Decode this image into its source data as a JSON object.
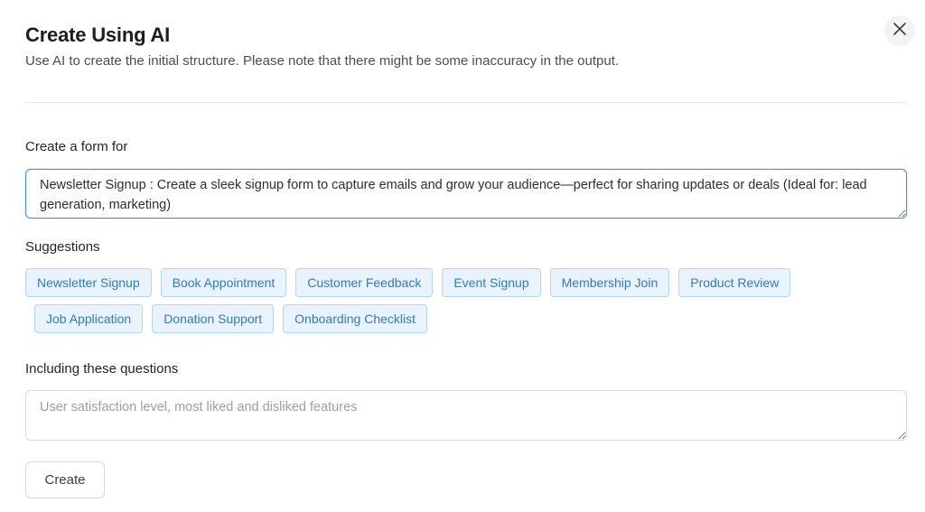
{
  "header": {
    "title": "Create Using AI",
    "subtitle": "Use AI to create the initial structure. Please note that there might be some inaccuracy in the output."
  },
  "form_for": {
    "label": "Create a form for",
    "value": "Newsletter Signup : Create a sleek signup form to capture emails and grow your audience—perfect for sharing updates or deals (Ideal for: lead generation, marketing)"
  },
  "suggestions": {
    "label": "Suggestions",
    "row1": [
      "Newsletter Signup",
      "Book Appointment",
      "Customer Feedback",
      "Event Signup",
      "Membership Join",
      "Product Review"
    ],
    "row2": [
      "Job Application",
      "Donation Support",
      "Onboarding Checklist"
    ]
  },
  "questions": {
    "label": "Including these questions",
    "value": "",
    "placeholder": "User satisfaction level, most liked and disliked features"
  },
  "actions": {
    "create_label": "Create"
  },
  "icons": {
    "close": "close-icon"
  },
  "colors": {
    "accent": "#4a90d9",
    "chip_bg": "#e9f3fd",
    "chip_text": "#2f7bc8"
  }
}
